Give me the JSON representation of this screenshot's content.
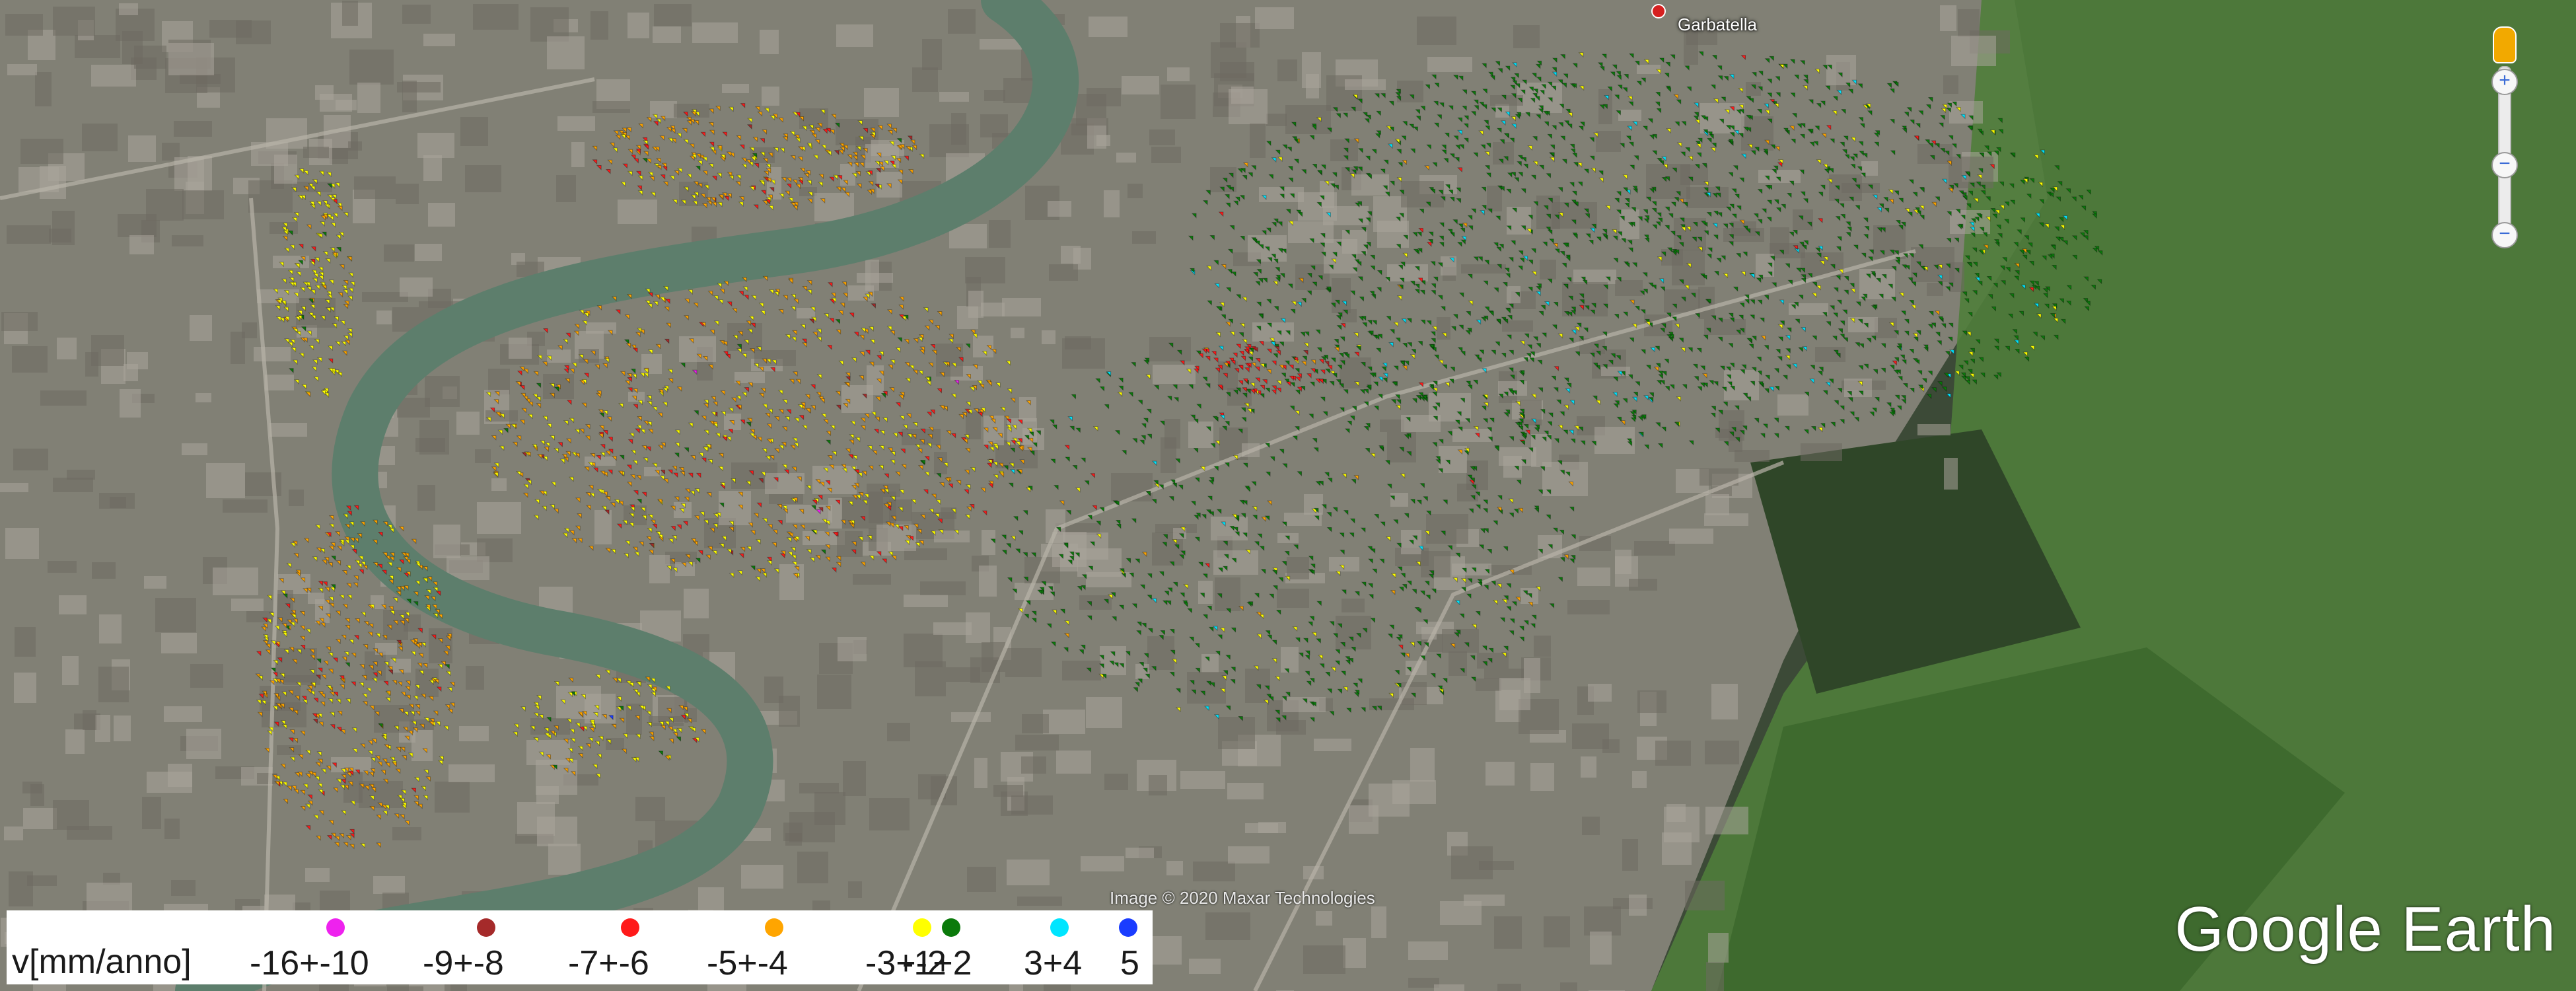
{
  "map": {
    "place_label": "Garbatella",
    "imagery_credit": "Image © 2020 Maxar Technologies",
    "brand": "Google Earth",
    "palette": {
      "land_dark": "#3c4a37",
      "urban": "#8d8a80",
      "river": "#5d7e6c",
      "park": "#2f4628",
      "field": "#4f7d3b"
    }
  },
  "zoom": {
    "plus": "+",
    "minus": "−",
    "mid": "−"
  },
  "legend": {
    "title": "v[mm/anno]",
    "items": [
      {
        "label": "-16+-10",
        "color": "#ee22ee"
      },
      {
        "label": "-9+-8",
        "color": "#a52a2a"
      },
      {
        "label": "-7+-6",
        "color": "#ff1a1a"
      },
      {
        "label": "-5+-4",
        "color": "#ffa500"
      },
      {
        "label": "-3+-2",
        "color": "#ffff00"
      },
      {
        "label": "-1+2",
        "color": "#0b7a0b"
      },
      {
        "label": "3+4",
        "color": "#00e5ff"
      },
      {
        "label": "5",
        "color": "#1a3cff"
      }
    ]
  }
}
